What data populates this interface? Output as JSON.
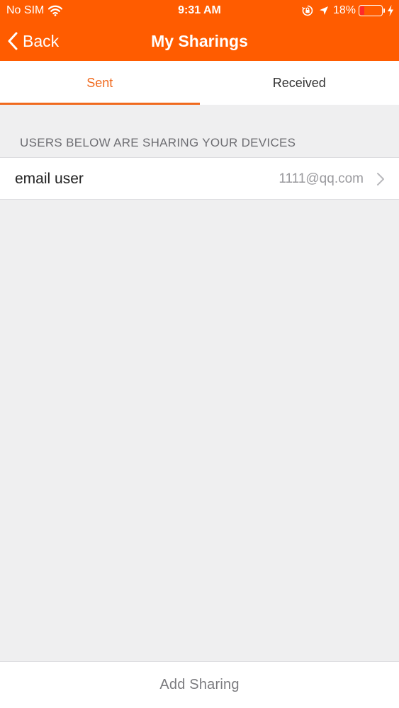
{
  "status_bar": {
    "carrier": "No SIM",
    "time": "9:31 AM",
    "battery_percent": "18%",
    "icons": [
      "wifi-icon",
      "lock-rotation-icon",
      "location-icon",
      "battery-icon",
      "bolt-icon"
    ]
  },
  "nav": {
    "back_label": "Back",
    "title": "My Sharings",
    "back_icon": "chevron-left-icon"
  },
  "tabs": [
    {
      "label": "Sent",
      "active": true
    },
    {
      "label": "Received",
      "active": false
    }
  ],
  "section": {
    "header": "USERS BELOW ARE SHARING YOUR DEVICES"
  },
  "list": {
    "items": [
      {
        "title": "email user",
        "detail": "1111@qq.com",
        "icon": "chevron-right-icon"
      }
    ]
  },
  "footer": {
    "add_label": "Add Sharing"
  },
  "colors": {
    "brand": "#ff5c00",
    "accent_tab": "#f06a1e",
    "background": "#efeff0",
    "battery_low": "#ff2a2a"
  }
}
